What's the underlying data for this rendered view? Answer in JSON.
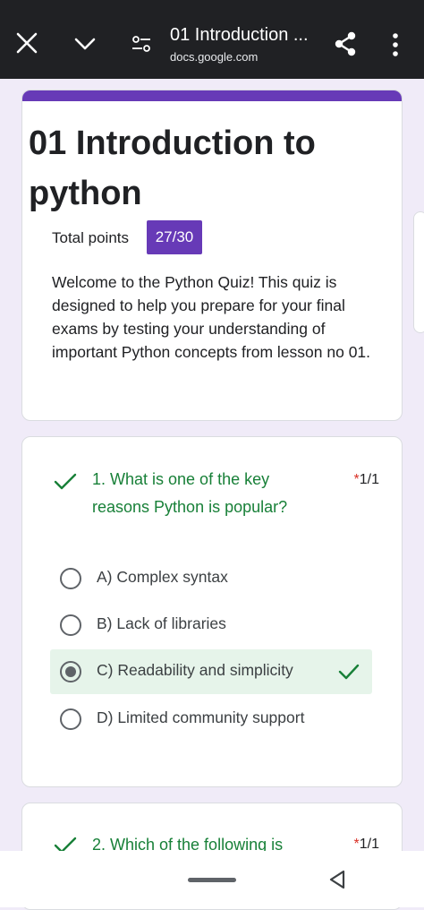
{
  "topbar": {
    "title": "01 Introduction ...",
    "url": "docs.google.com",
    "icons": [
      "close-icon",
      "chevron-down-icon",
      "tune-icon",
      "share-icon",
      "more-vert-icon"
    ]
  },
  "header": {
    "title": "01 Introduction to python",
    "points_label": "Total points",
    "points_value": "27/30",
    "description": "Welcome to the Python Quiz! This quiz is designed to help you prepare for your final exams by testing your understanding of important Python concepts from lesson no 01."
  },
  "questions": [
    {
      "text": "1. What is one of the key reasons Python is popular?",
      "required_mark": "*",
      "score": "1/1",
      "options": [
        {
          "label": "A) Complex syntax",
          "selected": false
        },
        {
          "label": "B) Lack of libraries",
          "selected": false
        },
        {
          "label": "C) Readability and simplicity",
          "selected": true,
          "correct": true
        },
        {
          "label": "D) Limited community support",
          "selected": false
        }
      ]
    },
    {
      "text": "2. Which of the following is",
      "required_mark": "*",
      "score": "1/1"
    }
  ],
  "colors": {
    "accent": "#673ab7",
    "correct": "#188038",
    "required": "#d93025",
    "page_bg": "#f0ebf8",
    "topbar_bg": "#202124"
  }
}
